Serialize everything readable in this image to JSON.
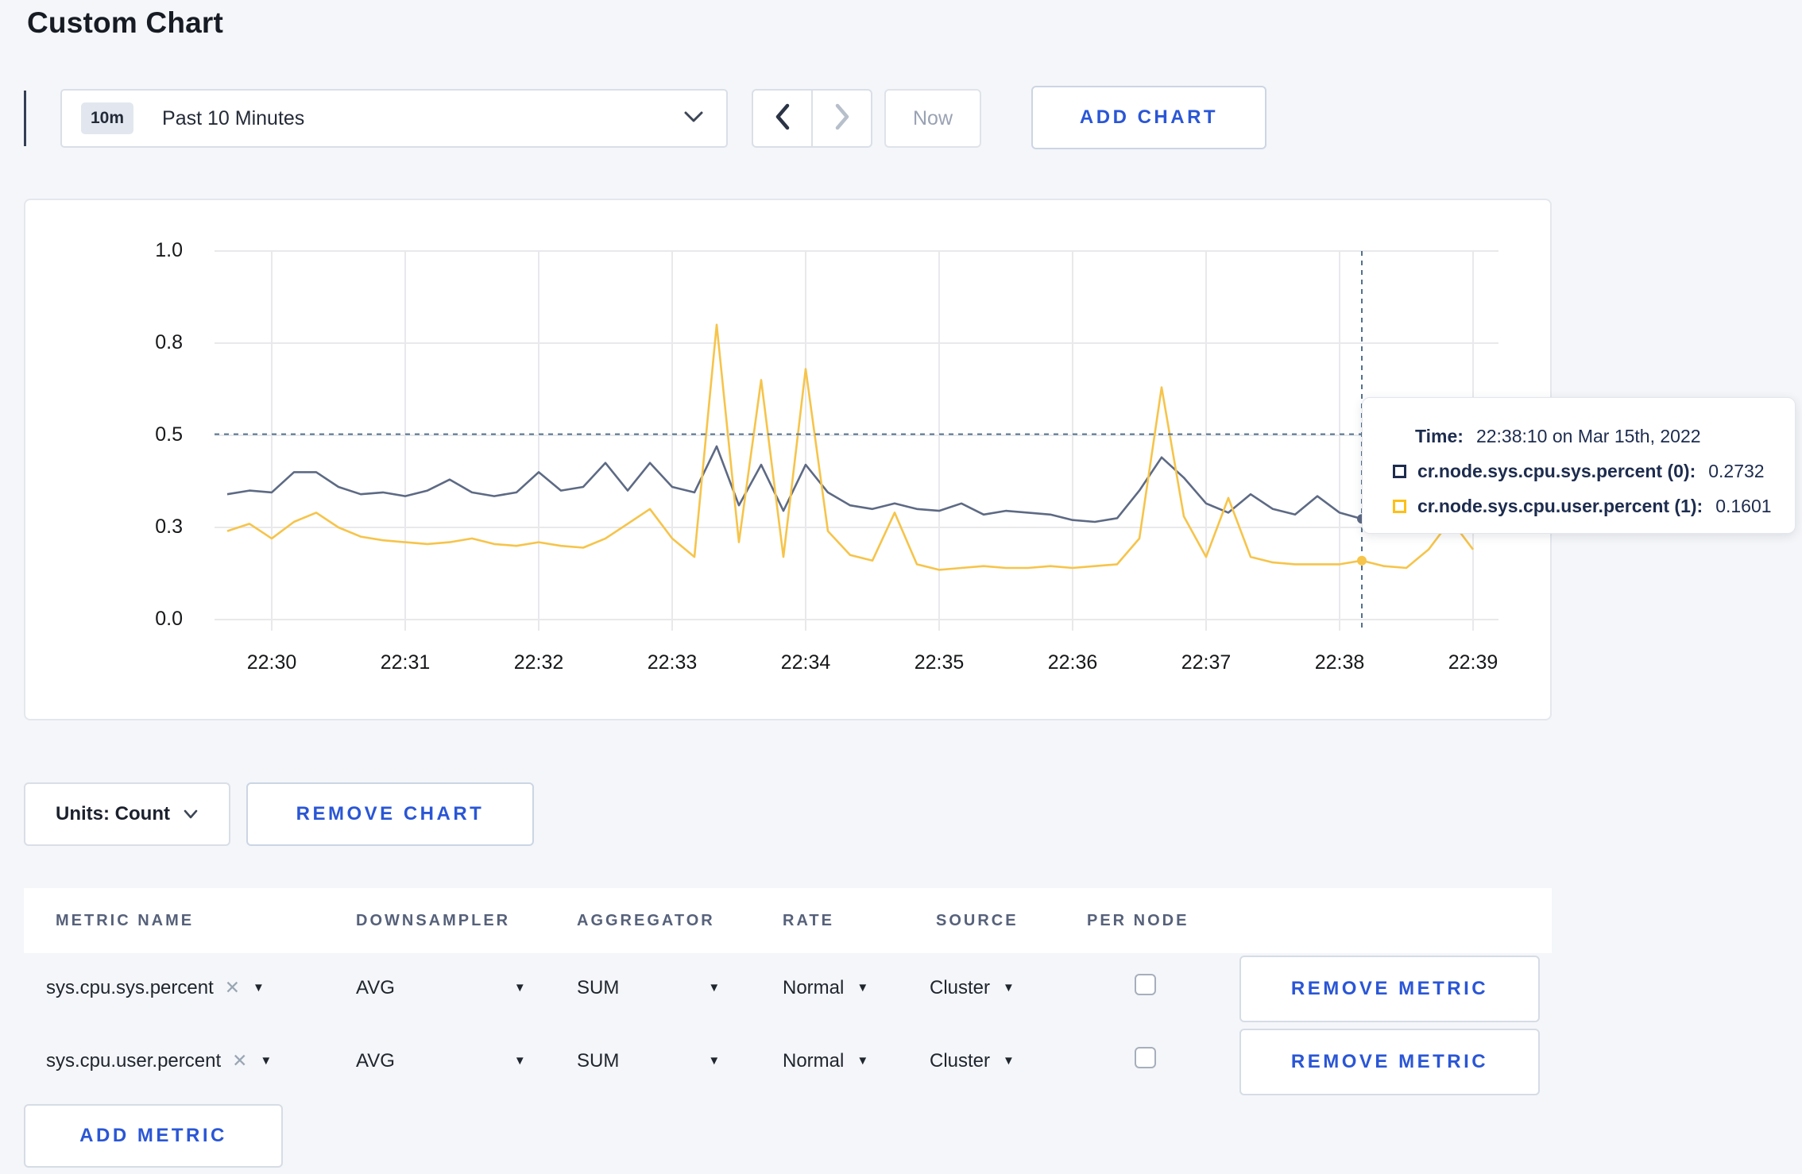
{
  "page": {
    "title": "Custom Chart"
  },
  "toolbar": {
    "range_badge": "10m",
    "range_label": "Past 10 Minutes",
    "prev_arrow": "‹",
    "next_arrow": "›",
    "now_label": "Now",
    "add_chart_label": "ADD CHART"
  },
  "colors": {
    "accent_blue": "#2a56d6",
    "series_sys": "#5d6a84",
    "series_user": "#f6c44a",
    "crosshair": "#53718e",
    "gridline": "#e9e9ec",
    "tooltip_text": "#1d2c4e",
    "legend_sys_swatch": "#1d2c4e",
    "legend_user_swatch": "#fdc018"
  },
  "chart_data": {
    "type": "line",
    "title": "",
    "xlabel": "",
    "ylabel": "",
    "ylim": [
      0,
      1
    ],
    "grid": true,
    "legend_position": "tooltip-only",
    "y_tick_values": [
      0,
      0.25,
      0.5,
      0.75,
      1.0
    ],
    "y_tick_labels": [
      "0.0",
      "0.3",
      "0.5",
      "0.8",
      "1.0"
    ],
    "x_tick_labels": [
      "22:30",
      "22:31",
      "22:32",
      "22:33",
      "22:34",
      "22:35",
      "22:36",
      "22:37",
      "22:38",
      "22:39"
    ],
    "x_start": "22:29:40",
    "x_end": "22:39:00",
    "sample_interval_seconds": 10,
    "start_offset_minutes": -0.3333,
    "series": [
      {
        "name": "cr.node.sys.cpu.sys.percent",
        "values": [
          0.34,
          0.35,
          0.345,
          0.4,
          0.4,
          0.36,
          0.34,
          0.345,
          0.335,
          0.35,
          0.38,
          0.345,
          0.335,
          0.345,
          0.4,
          0.35,
          0.36,
          0.425,
          0.35,
          0.425,
          0.36,
          0.345,
          0.47,
          0.31,
          0.42,
          0.295,
          0.42,
          0.345,
          0.31,
          0.3,
          0.315,
          0.3,
          0.295,
          0.315,
          0.285,
          0.295,
          0.29,
          0.285,
          0.27,
          0.265,
          0.275,
          0.35,
          0.44,
          0.385,
          0.315,
          0.29,
          0.34,
          0.3,
          0.285,
          0.335,
          0.29,
          0.2732,
          0.28,
          0.295,
          0.31,
          0.3,
          0.31
        ]
      },
      {
        "name": "cr.node.sys.cpu.user.percent",
        "values": [
          0.24,
          0.26,
          0.22,
          0.265,
          0.29,
          0.25,
          0.225,
          0.215,
          0.21,
          0.205,
          0.21,
          0.22,
          0.205,
          0.2,
          0.21,
          0.2,
          0.195,
          0.22,
          0.26,
          0.3,
          0.22,
          0.17,
          0.8,
          0.21,
          0.65,
          0.17,
          0.68,
          0.24,
          0.175,
          0.16,
          0.29,
          0.15,
          0.135,
          0.14,
          0.145,
          0.14,
          0.14,
          0.145,
          0.14,
          0.145,
          0.15,
          0.22,
          0.63,
          0.28,
          0.17,
          0.33,
          0.17,
          0.155,
          0.15,
          0.15,
          0.15,
          0.1601,
          0.145,
          0.14,
          0.19,
          0.27,
          0.19
        ]
      }
    ],
    "crosshair": {
      "time_minutes_from_2230": 8.1667,
      "hline_value": 0.503,
      "sys_value": 0.2732,
      "user_value": 0.1601
    }
  },
  "tooltip": {
    "time_label": "Time:",
    "time_value": "22:38:10 on Mar 15th, 2022",
    "rows": [
      {
        "label": "cr.node.sys.cpu.sys.percent (0):",
        "value": "0.2732"
      },
      {
        "label": "cr.node.sys.cpu.user.percent (1):",
        "value": "0.1601"
      }
    ]
  },
  "units_bar": {
    "units_label": "Units: Count",
    "remove_chart_label": "REMOVE CHART"
  },
  "metrics_table": {
    "headers": [
      "METRIC NAME",
      "DOWNSAMPLER",
      "AGGREGATOR",
      "RATE",
      "SOURCE",
      "PER NODE"
    ],
    "close_glyph": "✕",
    "rows": [
      {
        "metric": "sys.cpu.sys.percent",
        "downsampler": "AVG",
        "aggregator": "SUM",
        "rate": "Normal",
        "source": "Cluster",
        "per_node_checked": false,
        "remove_label": "REMOVE METRIC"
      },
      {
        "metric": "sys.cpu.user.percent",
        "downsampler": "AVG",
        "aggregator": "SUM",
        "rate": "Normal",
        "source": "Cluster",
        "per_node_checked": false,
        "remove_label": "REMOVE METRIC"
      }
    ],
    "add_metric_label": "ADD METRIC"
  }
}
